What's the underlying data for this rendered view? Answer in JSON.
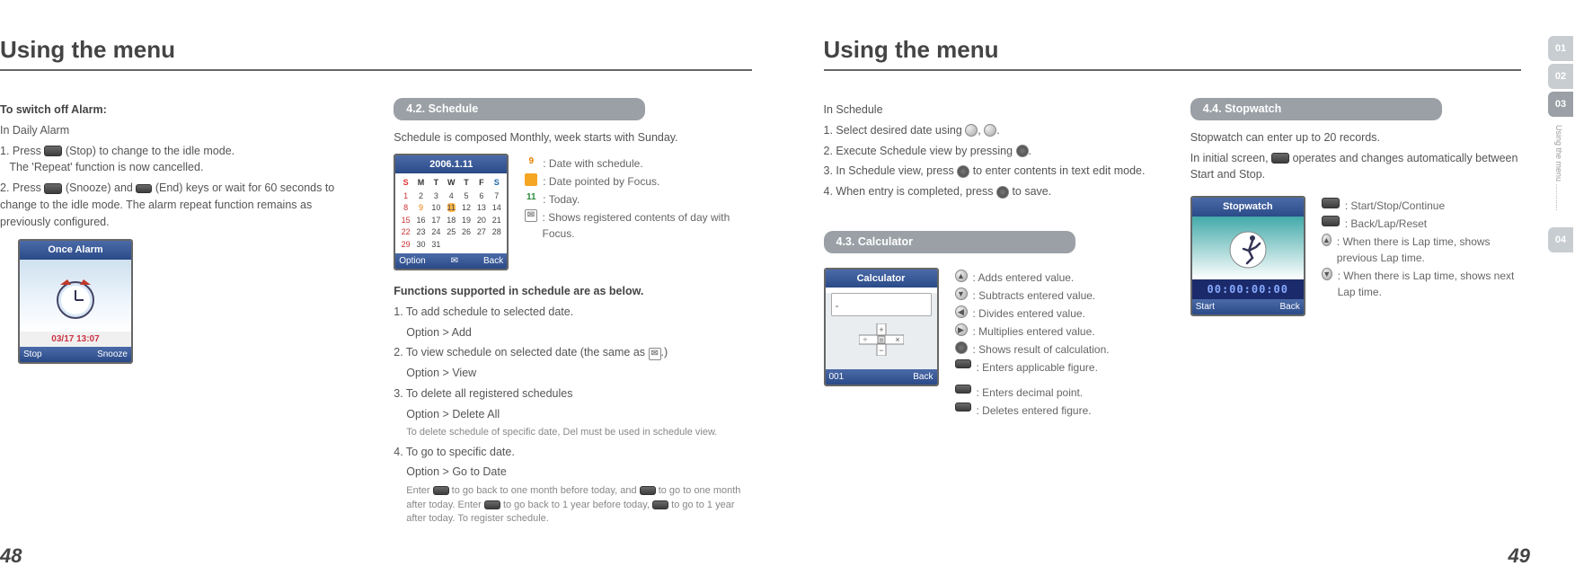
{
  "left": {
    "title": "Using the menu",
    "alarm": {
      "heading": "To switch off Alarm:",
      "sub": "In Daily Alarm",
      "s1a": "1. Press",
      "s1b": "(Stop) to change to the idle mode.",
      "s1c": "The 'Repeat' function is now cancelled.",
      "s2a": "2. Press",
      "s2b": "(Snooze) and",
      "s2c": "(End) keys or wait for 60 seconds to change to the idle mode. The alarm repeat function remains as previously configured."
    },
    "alarm_screen": {
      "title": "Once Alarm",
      "sub": "03/17 13:07",
      "left": "Stop",
      "right": "Snooze"
    },
    "schedule": {
      "tab": "4.2. Schedule",
      "intro": "Schedule is composed Monthly, week starts with Sunday."
    },
    "cal_screen": {
      "title": "2006.1.11",
      "left": "Option",
      "right": "Back"
    },
    "cal_legend": {
      "l1": "Date with schedule.",
      "l2": "Date pointed by Focus.",
      "l3": "Today.",
      "l4": "Shows registered contents of day with Focus."
    },
    "funcs": {
      "heading": "Functions supported in schedule are as below.",
      "f1a": "1. To add schedule to selected date.",
      "f1b": "Option > Add",
      "f2a": "2. To view schedule on selected date (the same as",
      "f2b": ".)",
      "f2c": "Option > View",
      "f3a": "3. To delete all registered schedules",
      "f3b": "Option > Delete All",
      "f3n": "To delete schedule of specific date, Del must be used in schedule view.",
      "f4a": "4. To go to specific date.",
      "f4b": "Option > Go to Date",
      "f4n1": "Enter",
      "f4n2": "to go back to one month before today, and",
      "f4n3": "to go to one month after today. Enter",
      "f4n4": "to go back to 1 year before today,",
      "f4n5": "to go to 1 year after today. To register schedule."
    },
    "pagenum": "48"
  },
  "right": {
    "title": "Using the menu",
    "sched_use": {
      "intro": "In Schedule",
      "s1a": "1. Select desired date using",
      "s1b": ",",
      "s1c": ".",
      "s2a": "2. Execute Schedule view by pressing",
      "s2b": ".",
      "s3a": "3. In Schedule view, press",
      "s3b": "to enter contents in text edit mode.",
      "s4a": "4. When entry is completed, press",
      "s4b": "to save."
    },
    "calc": {
      "tab": "4.3. Calculator",
      "screen_title": "Calculator",
      "screen_left": "001",
      "screen_right": "Back",
      "l1": ": Adds entered value.",
      "l2": ": Subtracts entered value.",
      "l3": ": Divides entered value.",
      "l4": ": Multiplies entered value.",
      "l5": ": Shows result of calculation.",
      "l6": ": Enters applicable figure.",
      "l7": ": Enters decimal point.",
      "l8": ": Deletes entered figure."
    },
    "sw": {
      "tab": "4.4. Stopwatch",
      "p1": "Stopwatch can enter up to 20 records.",
      "p2a": "In initial screen,",
      "p2b": "operates and changes automatically between Start and Stop.",
      "screen_title": "Stopwatch",
      "screen_time": "00:00:00:00",
      "screen_left": "Start",
      "screen_right": "Back",
      "l1": ": Start/Stop/Continue",
      "l2": ": Back/Lap/Reset",
      "l3": ": When there is Lap time, shows previous Lap time.",
      "l4": ": When there is Lap time, shows next Lap time."
    },
    "pagenum": "49",
    "tabs": {
      "t1": "01",
      "t2": "02",
      "t3": "03",
      "t4": "04",
      "label": "Using the menu ............"
    }
  }
}
